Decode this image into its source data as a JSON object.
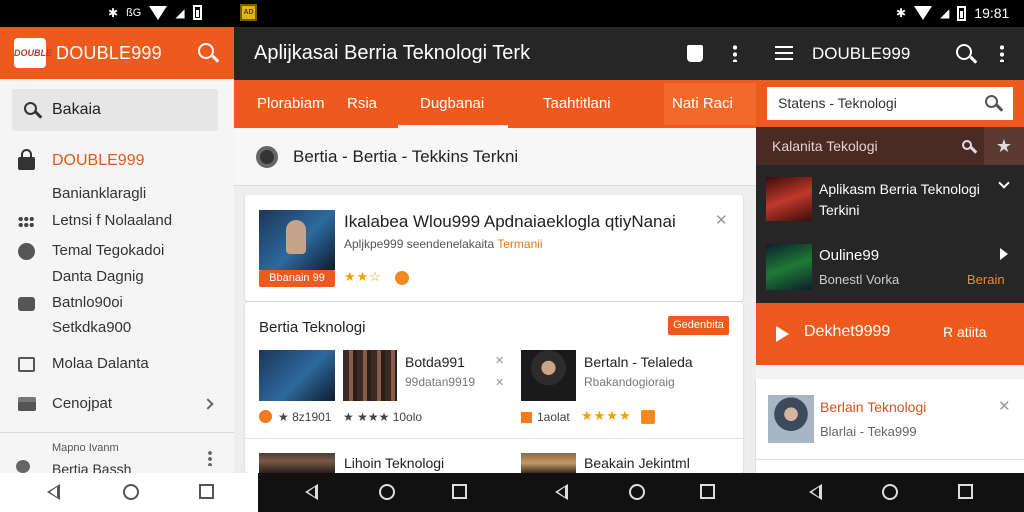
{
  "status": {
    "time": "19:81"
  },
  "panel1": {
    "logo_text": "DOUBLE",
    "title": "DOUBLE999",
    "search_text": "Bakaia",
    "brand_item": "DOUBLE999",
    "items": [
      "Banianklaragli",
      "Letnsi f Nolaaland",
      "Temal Tegokadoi",
      "Danta Dagnig",
      "Batnlo90oi",
      "Setkdka900",
      "Molaa Dalanta",
      "Cenojpat"
    ],
    "footer_label": "Mapno Ivanm",
    "footer_item": "Bertia Bassh"
  },
  "panel2": {
    "title": "Aplijkasai Berria Teknologi Terk",
    "tabs": [
      "Plorabiam",
      "Rsia",
      "Dugbanai",
      "Taahtitlani",
      "Nati Raci"
    ],
    "header": "Bertia - Bertia - Tekkins Terkni",
    "feature": {
      "title": "Ikalabea Wlou999 Apdnaiaeklogla qtiyNanai",
      "subtitle_a": "Apljkpe999 seendenelakaita ",
      "subtitle_b": "Termanii",
      "chip": "Bbanain 99",
      "stars": "★★☆"
    },
    "section": {
      "title": "Bertia Teknologi",
      "badge": "Gedenbita",
      "story1": {
        "title": "Botda991",
        "sub": "99datan9919"
      },
      "story2": {
        "title": "Bertaln - Telaleda",
        "sub": "Rbakandogioraig"
      },
      "rating1": "★ 8z1901",
      "rating2": "★ ★★★ 10olo",
      "rating3": "1aolat",
      "rating4": "★★★★"
    },
    "bottom": {
      "story1": "Lihoin Teknologi",
      "story2": "Beakain Jekintml"
    }
  },
  "panel3": {
    "title": "DOUBLE999",
    "search_text": "Statens - Teknologi",
    "dark_head": "Kalanita Tekologi",
    "row1_title": "Aplikasm Berria Teknologi Terkini",
    "row2_title": "Ouline99",
    "row2_sub": "Bonestl Vorka",
    "row2_link": "Berain",
    "cta_label": "Dekhet9999",
    "cta_right": "R atiita",
    "card_title": "Berlain Teknologi",
    "card_sub": "Blarlai - Teka999"
  },
  "colors": {
    "accent": "#ee5a1d",
    "dark": "#262626",
    "nav_dark": "#111111"
  },
  "icons": {
    "search": "search-icon",
    "menu": "menu-icon",
    "more": "more-vert-icon",
    "close": "close-icon",
    "star": "star-icon"
  }
}
